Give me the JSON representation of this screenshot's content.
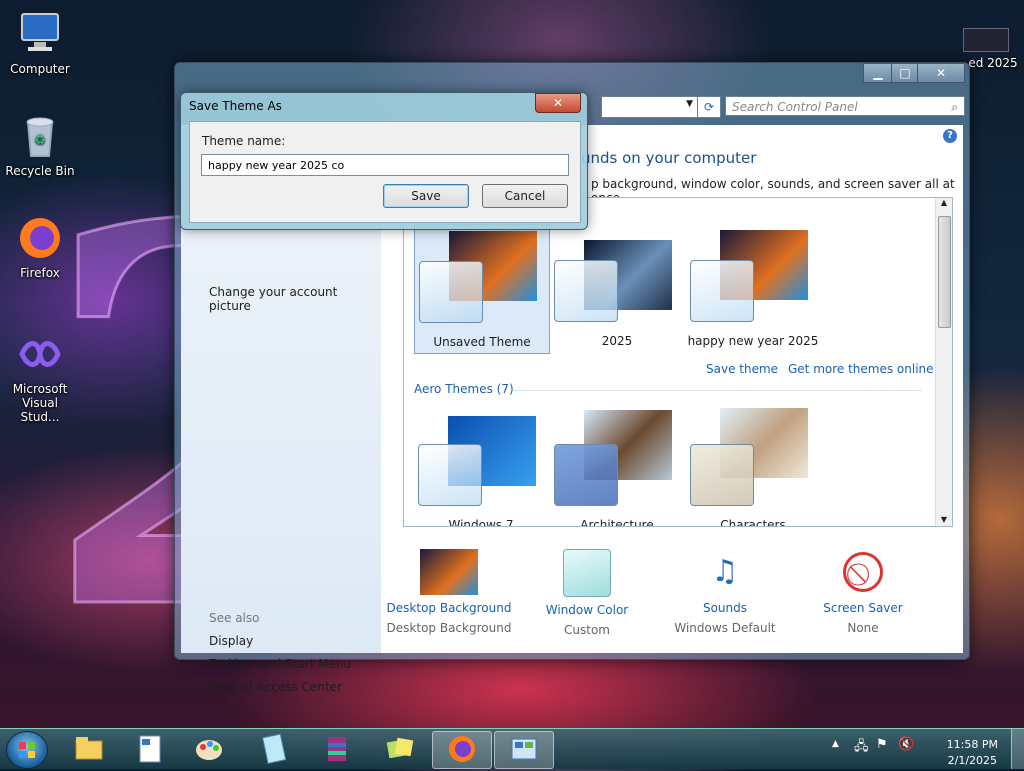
{
  "desktop": {
    "icons": [
      {
        "label": "Computer",
        "icon": "computer-icon"
      },
      {
        "label": "Recycle Bin",
        "icon": "recycle-bin-icon"
      },
      {
        "label": "Firefox",
        "icon": "firefox-icon"
      },
      {
        "label_line1": "Microsoft",
        "label_line2": "Visual Stud...",
        "icon": "visual-studio-icon"
      }
    ],
    "right_icon_label": "ed 2025"
  },
  "control_panel": {
    "search_placeholder": "Search Control Panel",
    "heading": "unds on your computer",
    "subheading": "p background, window color, sounds, and screen saver all at once.",
    "left": {
      "change_picture": "Change your account picture",
      "see_also": "See also",
      "links": [
        "Display",
        "Taskbar and Start Menu",
        "Ease of Access Center"
      ]
    },
    "my_themes": [
      {
        "label": "Unsaved Theme",
        "selected": true
      },
      {
        "label": "2025",
        "selected": false
      },
      {
        "label": "happy new year 2025",
        "selected": false
      }
    ],
    "save_theme": "Save theme",
    "get_more": "Get more themes online",
    "aero_heading": "Aero Themes (7)",
    "aero_themes": [
      {
        "label": "Windows 7"
      },
      {
        "label": "Architecture"
      },
      {
        "label": "Characters"
      }
    ],
    "bottom": [
      {
        "title": "Desktop Background",
        "sub": "Desktop Background"
      },
      {
        "title": "Window Color",
        "sub": "Custom"
      },
      {
        "title": "Sounds",
        "sub": "Windows Default"
      },
      {
        "title": "Screen Saver",
        "sub": "None"
      }
    ]
  },
  "dialog": {
    "title": "Save Theme As",
    "label": "Theme name:",
    "value": "happy new year 2025 co",
    "save": "Save",
    "cancel": "Cancel",
    "close": "✕"
  },
  "taskbar": {
    "time": "11:58 PM",
    "date": "2/1/2025",
    "apps": [
      "explorer-icon",
      "wordpad-icon",
      "paint-icon",
      "notepad-icon",
      "winrar-icon",
      "sticky-notes-icon",
      "firefox-icon",
      "control-panel-icon"
    ]
  },
  "colors": {
    "accent": "#1a5fb4",
    "heading": "#1e4f8f"
  }
}
